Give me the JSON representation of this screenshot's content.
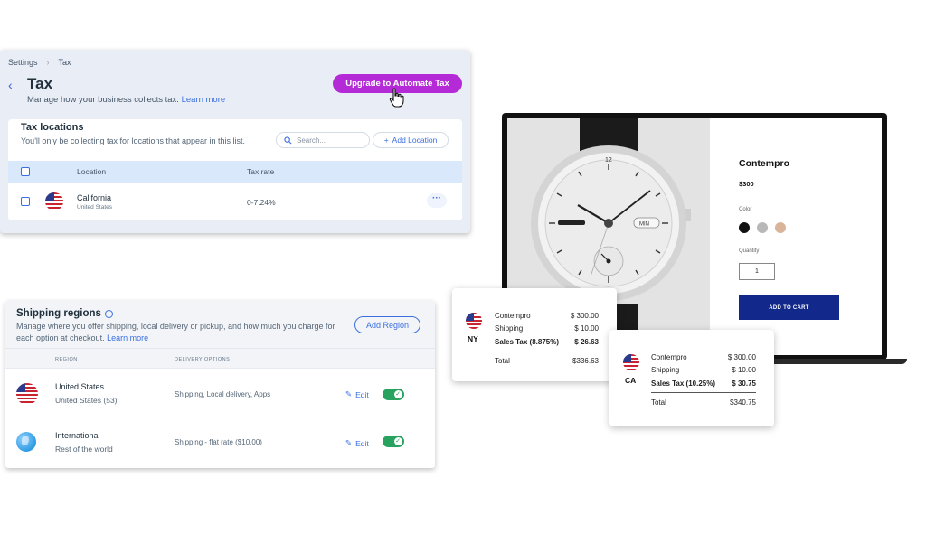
{
  "tax": {
    "breadcrumb": [
      "Settings",
      "Tax"
    ],
    "title": "Tax",
    "subtitle": "Manage how your business collects tax.",
    "learn_more": "Learn more",
    "upgrade_button": "Upgrade to Automate Tax",
    "locations": {
      "title": "Tax locations",
      "description": "You'll only be collecting tax for locations that appear in this list.",
      "search_placeholder": "Search...",
      "add_button": "Add Location",
      "columns": [
        "Location",
        "Tax rate"
      ],
      "rows": [
        {
          "name": "California",
          "country": "United States",
          "rate": "0-7.24%"
        }
      ]
    }
  },
  "shipping": {
    "title": "Shipping regions",
    "description": "Manage where you offer shipping, local delivery or pickup, and how much you charge for each option at checkout.",
    "learn_more": "Learn more",
    "add_button": "Add Region",
    "columns": [
      "REGION",
      "DELIVERY OPTIONS"
    ],
    "rows": [
      {
        "name": "United States",
        "sub": "United States (53)",
        "options": "Shipping, Local delivery, Apps",
        "edit": "Edit",
        "enabled": true
      },
      {
        "name": "International",
        "sub": "Rest of the world",
        "options": "Shipping - flat rate  ($10.00)",
        "edit": "Edit",
        "enabled": true
      }
    ]
  },
  "product": {
    "name": "Contempro",
    "price": "$300",
    "color_label": "Color",
    "colors": [
      "#111111",
      "#b8b8b8",
      "#d9b49a"
    ],
    "quantity_label": "Quantity",
    "quantity": "1",
    "cart_button": "ADD TO CART",
    "watch_label": "MIN"
  },
  "receipts": [
    {
      "state": "NY",
      "lines": [
        {
          "label": "Contempro",
          "value": "$ 300.00"
        },
        {
          "label": "Shipping",
          "value": "$ 10.00"
        },
        {
          "label": "Sales Tax (8.875%)",
          "value": "$ 26.63",
          "bold": true
        }
      ],
      "total_label": "Total",
      "total": "$336.63"
    },
    {
      "state": "CA",
      "lines": [
        {
          "label": "Contempro",
          "value": "$ 300.00"
        },
        {
          "label": "Shipping",
          "value": "$ 10.00"
        },
        {
          "label": "Sales Tax (10.25%)",
          "value": "$ 30.75",
          "bold": true
        }
      ],
      "total_label": "Total",
      "total": "$340.75"
    }
  ]
}
